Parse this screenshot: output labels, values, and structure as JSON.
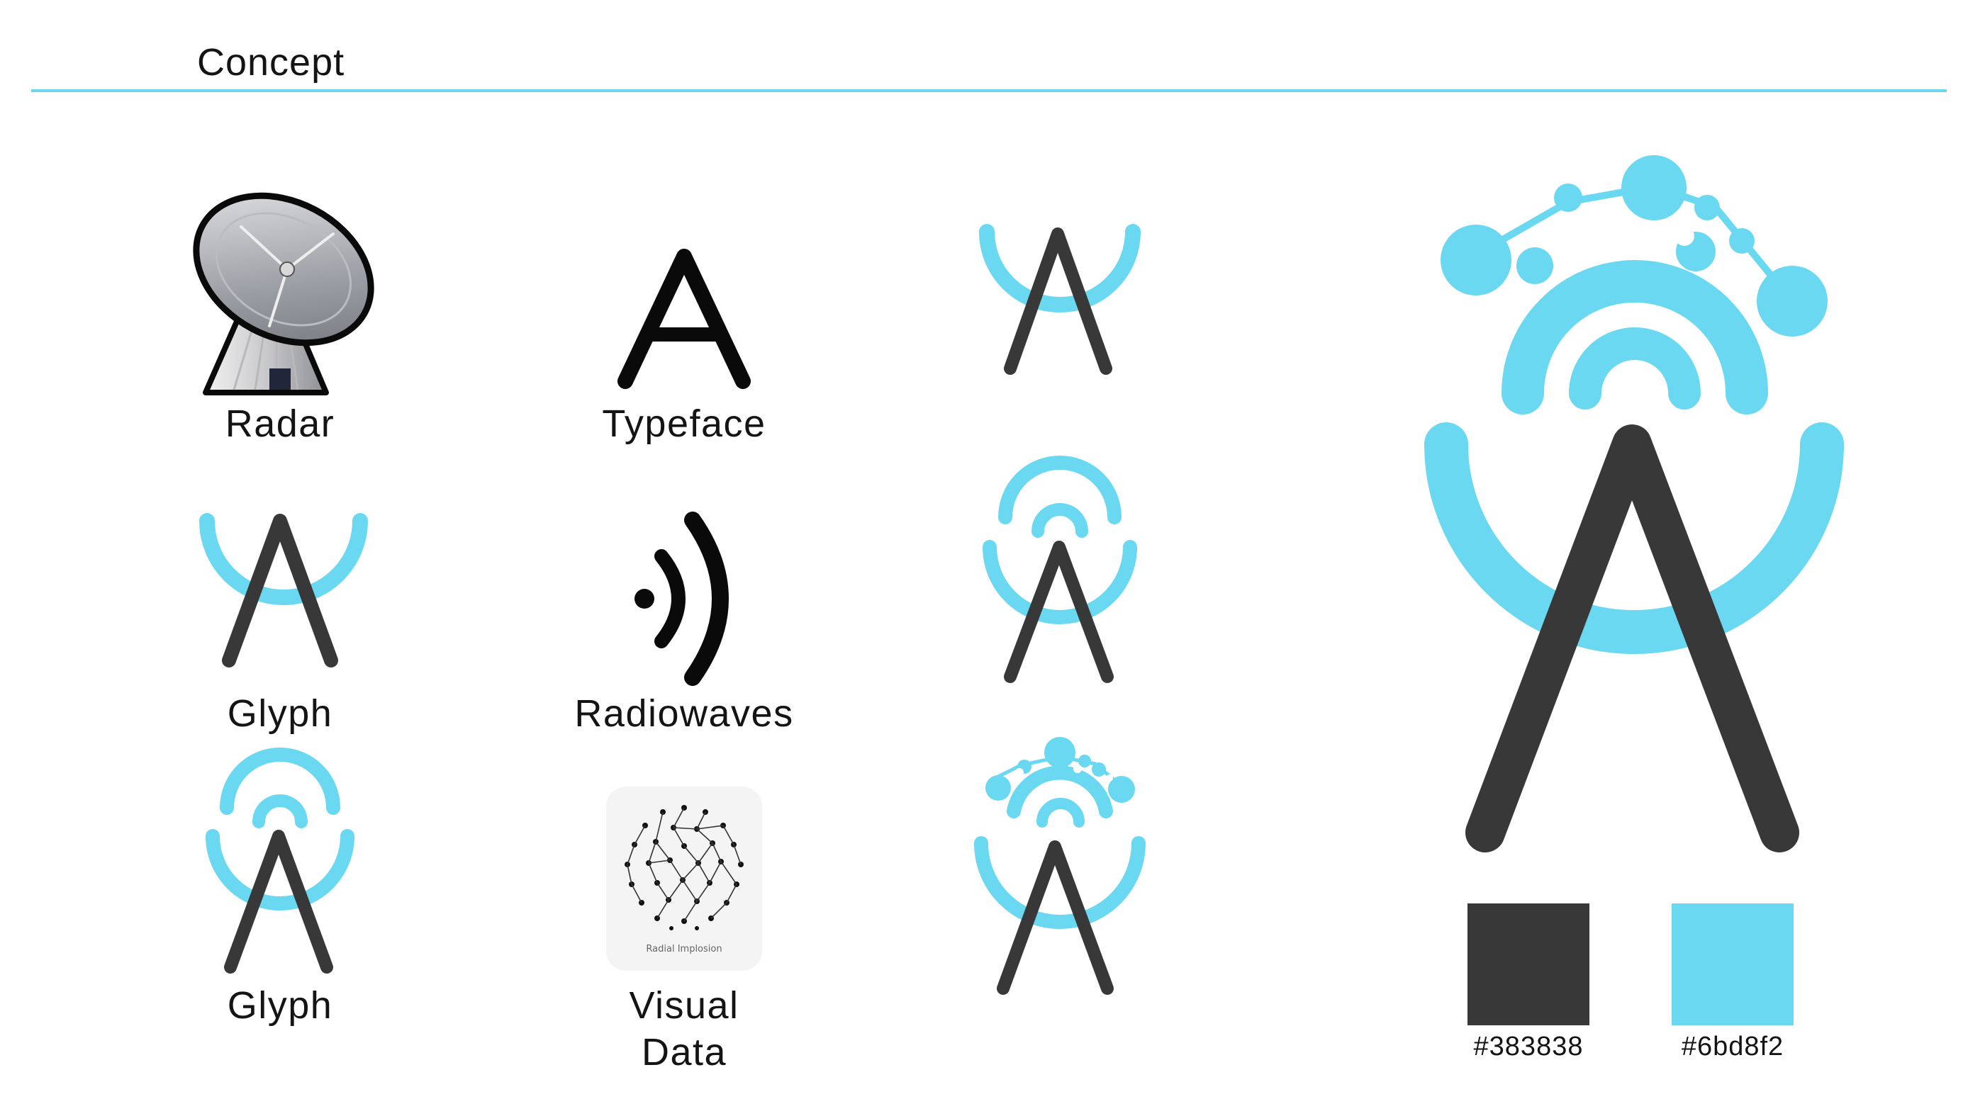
{
  "header": {
    "title": "Concept"
  },
  "concepts": [
    {
      "label": "Radar"
    },
    {
      "label": "Typeface"
    },
    {
      "label": "Glyph"
    },
    {
      "label": "Radiowaves"
    },
    {
      "label": "Glyph"
    },
    {
      "label": "Visual Data",
      "line1": "Visual",
      "line2": "Data",
      "image_caption": "Radial Implosion"
    }
  ],
  "typeface_sample": "A",
  "palette": {
    "dark": "#383838",
    "accent": "#6bd8f2",
    "labels": [
      "#383838",
      "#6bd8f2"
    ]
  },
  "icons": [
    "radar-dish-icon",
    "letter-a-icon",
    "glyph-a-arc-icon",
    "radio-waves-icon",
    "glyph-a-waves-icon",
    "radial-data-icon",
    "logo-mark-icon"
  ]
}
